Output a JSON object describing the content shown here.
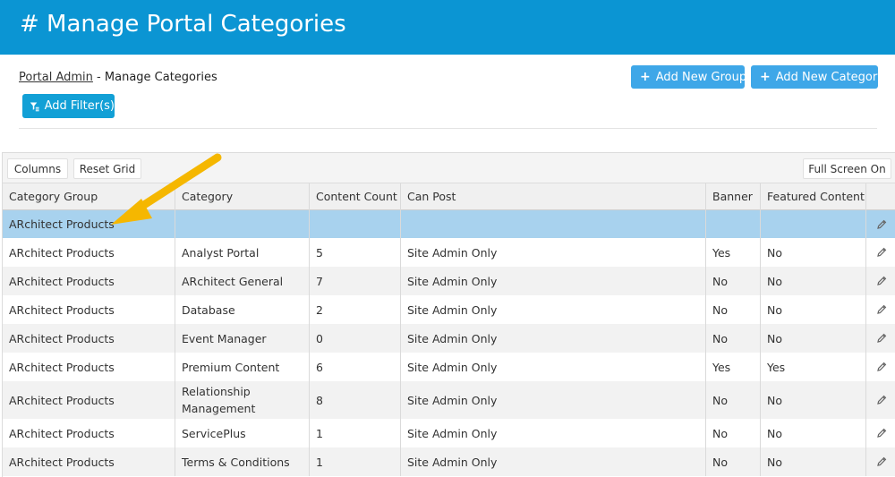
{
  "header": {
    "title": "# Manage Portal Categories"
  },
  "breadcrumb": {
    "parent": "Portal Admin",
    "separator": " - ",
    "current": "Manage Categories"
  },
  "actions": {
    "add_group": "Add New Group",
    "add_category": "Add New Category",
    "add_filter": "Add Filter(s)"
  },
  "toolbar": {
    "columns": "Columns",
    "reset": "Reset Grid",
    "fullscreen": "Full Screen On"
  },
  "columns": [
    "Category Group",
    "Category",
    "Content Count",
    "Can Post",
    "Banner",
    "Featured Content"
  ],
  "rows": [
    {
      "group": "ARchitect Products",
      "category": "",
      "count": "",
      "can_post": "",
      "banner": "",
      "featured": "",
      "selected": true
    },
    {
      "group": "ARchitect Products",
      "category": "Analyst Portal",
      "count": "5",
      "can_post": "Site Admin Only",
      "banner": "Yes",
      "featured": "No"
    },
    {
      "group": "ARchitect Products",
      "category": "ARchitect General",
      "count": "7",
      "can_post": "Site Admin Only",
      "banner": "No",
      "featured": "No"
    },
    {
      "group": "ARchitect Products",
      "category": "Database",
      "count": "2",
      "can_post": "Site Admin Only",
      "banner": "No",
      "featured": "No"
    },
    {
      "group": "ARchitect Products",
      "category": "Event Manager",
      "count": "0",
      "can_post": "Site Admin Only",
      "banner": "No",
      "featured": "No"
    },
    {
      "group": "ARchitect Products",
      "category": "Premium Content",
      "count": "6",
      "can_post": "Site Admin Only",
      "banner": "Yes",
      "featured": "Yes"
    },
    {
      "group": "ARchitect Products",
      "category": "Relationship Management",
      "count": "8",
      "can_post": "Site Admin Only",
      "banner": "No",
      "featured": "No"
    },
    {
      "group": "ARchitect Products",
      "category": "ServicePlus",
      "count": "1",
      "can_post": "Site Admin Only",
      "banner": "No",
      "featured": "No"
    },
    {
      "group": "ARchitect Products",
      "category": "Terms & Conditions",
      "count": "1",
      "can_post": "Site Admin Only",
      "banner": "No",
      "featured": "No"
    }
  ],
  "colors": {
    "header": "#0b95d3",
    "button": "#3ea7e8",
    "selected_row": "#a8d2ee",
    "arrow": "#f5b700"
  },
  "icons": {
    "edit": "pencil-icon",
    "filter": "filter-icon",
    "add": "plus-icon"
  }
}
